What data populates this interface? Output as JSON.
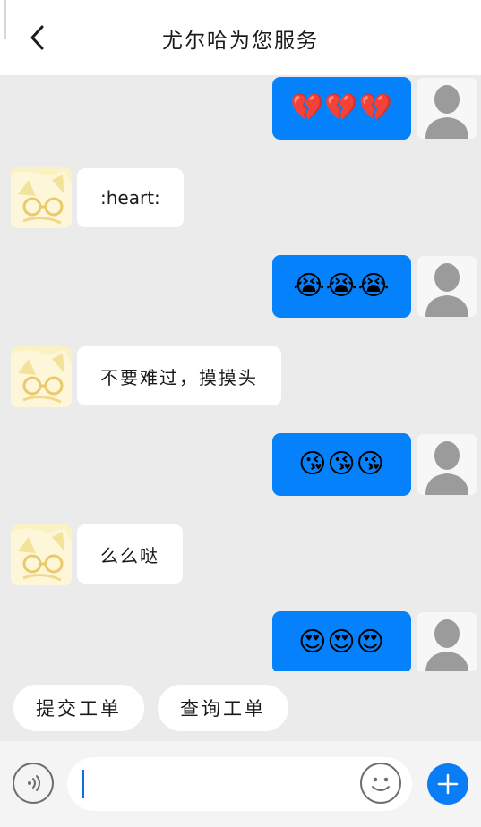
{
  "header": {
    "title": "尤尔哈为您服务",
    "back_icon": "chevron-left-icon"
  },
  "messages": [
    {
      "side": "out",
      "content": "💔💔💔"
    },
    {
      "side": "in",
      "content": ":heart:"
    },
    {
      "side": "out",
      "content": "😭😭😭"
    },
    {
      "side": "in",
      "content": "不要难过，摸摸头"
    },
    {
      "side": "out",
      "content": "😘😘😘"
    },
    {
      "side": "in",
      "content": "么么哒"
    },
    {
      "side": "out",
      "content": "😍😍😍"
    }
  ],
  "quick_actions": {
    "submit_ticket": "提交工单",
    "query_ticket": "查询工单"
  },
  "input_bar": {
    "voice_icon": "voice-icon",
    "emoji_icon": "smiley-icon",
    "plus_icon": "plus-icon",
    "value": ""
  },
  "colors": {
    "outgoing_bubble": "#0582fb",
    "incoming_bubble": "#ffffff",
    "background": "#ebebeb",
    "plus_button": "#0a7cf5"
  }
}
